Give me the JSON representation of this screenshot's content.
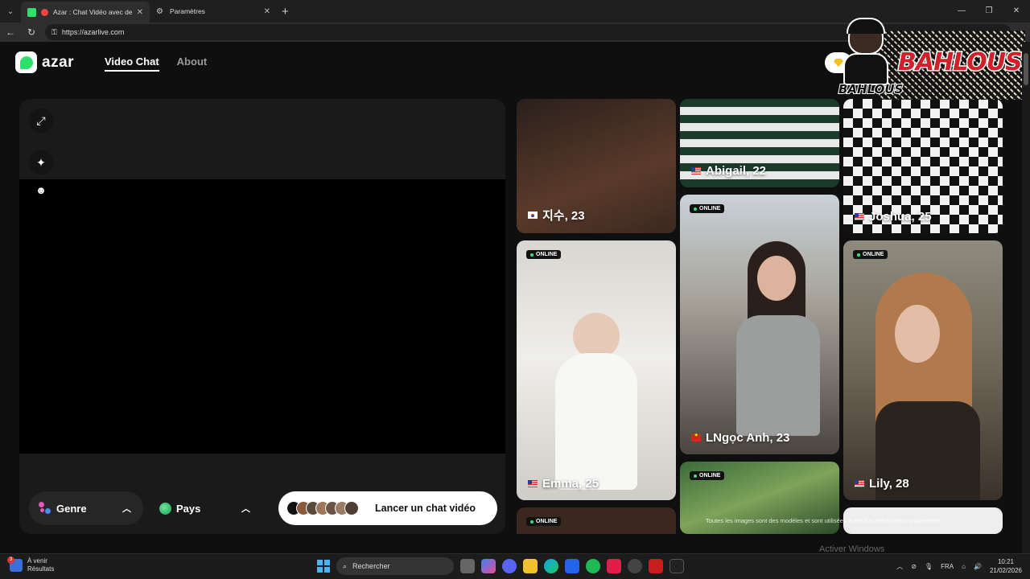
{
  "browser": {
    "tabs": [
      {
        "title": "Azar : Chat Vidéo avec de nou",
        "active": true
      },
      {
        "title": "Paramètres",
        "active": false
      }
    ],
    "url": "https://azarlive.com"
  },
  "header": {
    "logo_text": "azar",
    "nav": [
      {
        "label": "Video Chat",
        "active": true
      },
      {
        "label": "About",
        "active": false
      }
    ]
  },
  "overlay": {
    "title": "BAHLOUS",
    "small_title": "BAHLOUS"
  },
  "controls": {
    "genre_label": "Genre",
    "pays_label": "Pays",
    "launch_label": "Lancer un chat vidéo"
  },
  "profiles": [
    {
      "name": "지수, 23",
      "flag": "kr",
      "online": false
    },
    {
      "name": "Abigail, 22",
      "flag": "us",
      "online": false
    },
    {
      "name": "Joshua, 25",
      "flag": "us",
      "online": false
    },
    {
      "name": "Emma, 25",
      "flag": "us",
      "online": true
    },
    {
      "name": "LNgọc Anh, 23",
      "flag": "vn",
      "online": true
    },
    {
      "name": "Lily, 28",
      "flag": "us",
      "online": true
    },
    {
      "name": "",
      "flag": "",
      "online": true
    },
    {
      "name": "",
      "flag": "",
      "online": true
    }
  ],
  "online_label": "ONLINE",
  "disclaimer": "Toutes les images sont des modèles et sont utilisées à des fins d'illustration uniquement.",
  "watermark": "Activer Windows",
  "taskbar": {
    "weather_line1": "À venir",
    "weather_line2": "Résultats",
    "badge": "3",
    "search_placeholder": "Rechercher",
    "language": "FRA",
    "time": "10:21",
    "date": "21/02/2026"
  }
}
